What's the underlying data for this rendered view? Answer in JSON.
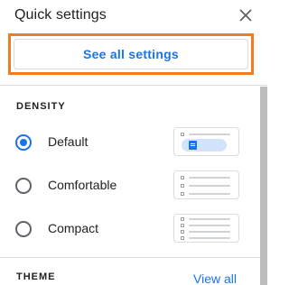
{
  "header": {
    "title": "Quick settings",
    "close_icon": "close-icon"
  },
  "see_all_settings": {
    "label": "See all settings",
    "highlight_color": "#ef7d22"
  },
  "density": {
    "label": "DENSITY",
    "selected": "Default",
    "options": [
      {
        "label": "Default",
        "selected": true
      },
      {
        "label": "Comfortable",
        "selected": false
      },
      {
        "label": "Compact",
        "selected": false
      }
    ]
  },
  "theme": {
    "label": "THEME",
    "view_all_label": "View all"
  },
  "colors": {
    "accent": "#1a73e8",
    "text": "#202124",
    "divider": "#dadce0"
  }
}
